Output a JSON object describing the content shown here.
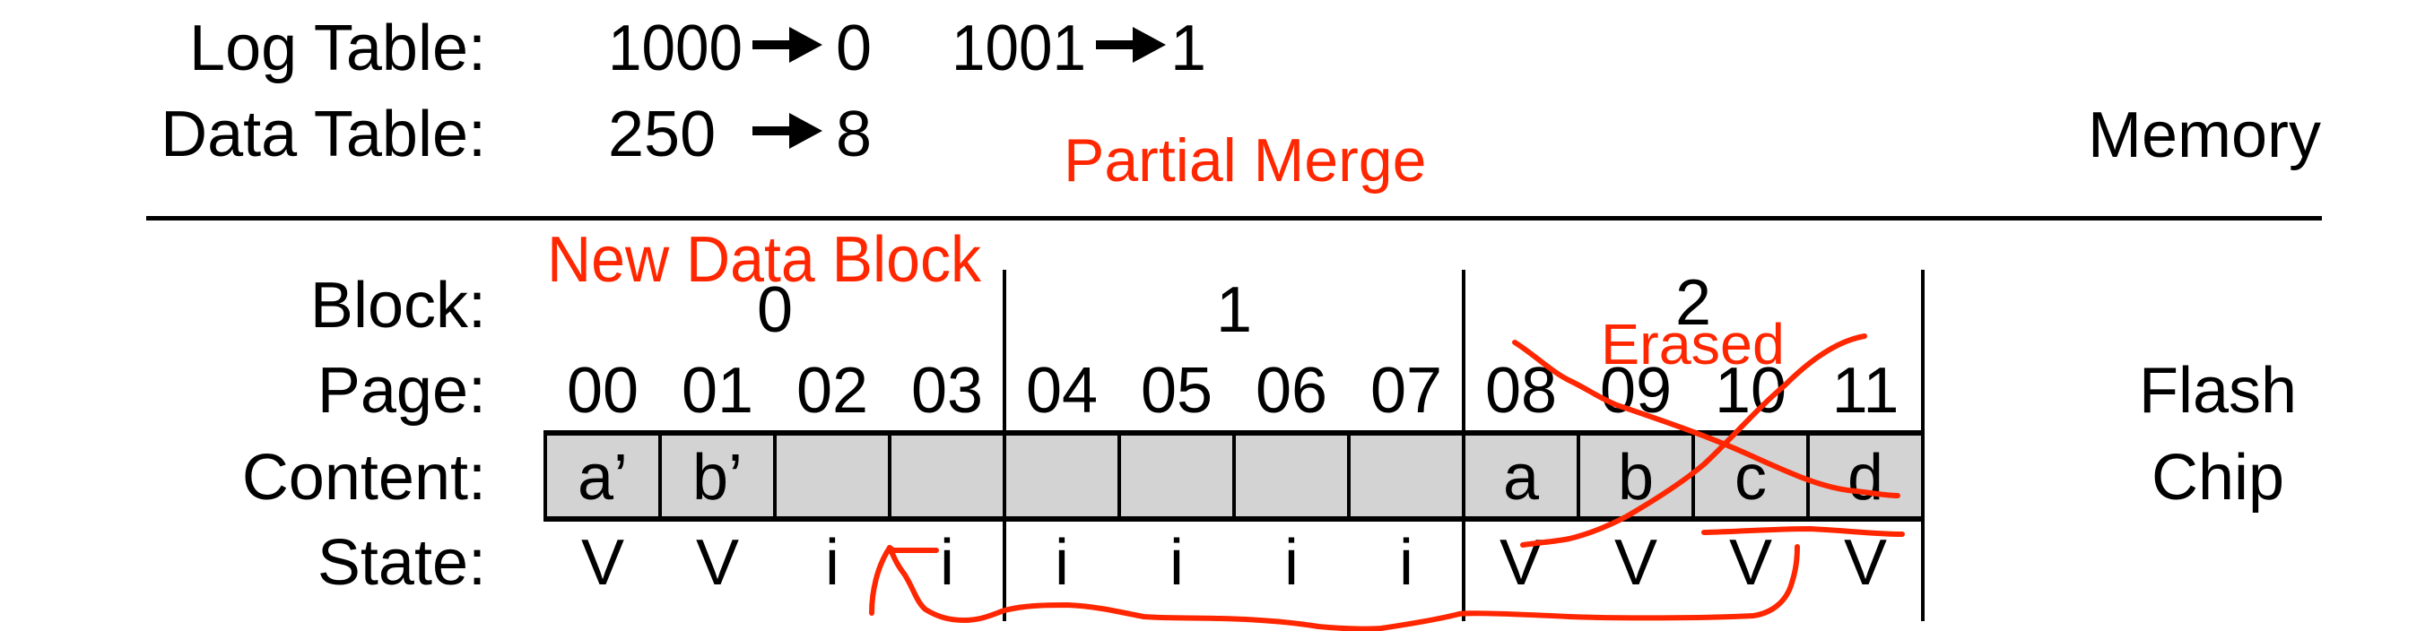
{
  "memory": {
    "label": "Memory",
    "log_table": {
      "label": "Log Table:",
      "entries": [
        {
          "from": "1000",
          "to": "0"
        },
        {
          "from": "1001",
          "to": "1"
        }
      ]
    },
    "data_table": {
      "label": "Data Table:",
      "entries": [
        {
          "from": "250",
          "to": "8"
        }
      ]
    }
  },
  "annotations": {
    "partial_merge": "Partial Merge",
    "new_data_block": "New Data Block",
    "erased": "Erased",
    "color": "#ff2600"
  },
  "flash": {
    "label_line1": "Flash",
    "label_line2": "Chip",
    "row_labels": {
      "block": "Block:",
      "page": "Page:",
      "content": "Content:",
      "state": "State:"
    },
    "blocks": [
      "0",
      "1",
      "2"
    ],
    "pages": [
      "00",
      "01",
      "02",
      "03",
      "04",
      "05",
      "06",
      "07",
      "08",
      "09",
      "10",
      "11"
    ],
    "content": [
      "a’",
      "b’",
      "",
      "",
      "",
      "",
      "",
      "",
      "a",
      "b",
      "c",
      "d"
    ],
    "state": [
      "V",
      "V",
      "i",
      "i",
      "i",
      "i",
      "i",
      "i",
      "V",
      "V",
      "V",
      "V"
    ],
    "cell_fill": "#d3d3d3"
  }
}
